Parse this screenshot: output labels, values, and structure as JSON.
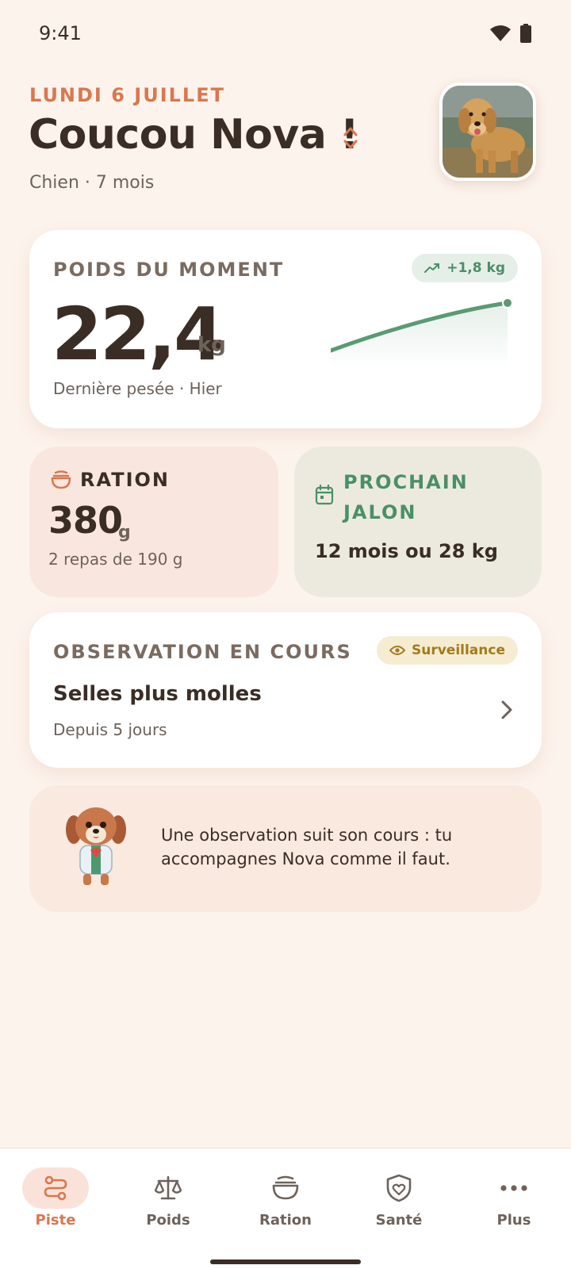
{
  "status_bar": {
    "time": "9:41",
    "icons": [
      "wifi-icon",
      "battery-icon"
    ]
  },
  "header": {
    "date": "LUNDI 6 JUILLET",
    "greeting": "Coucou Nova !",
    "subtitle": "Chien · 7 mois",
    "avatar": "golden-retriever-photo"
  },
  "weight_card": {
    "label": "POIDS DU MOMENT",
    "trend": "+1,8 kg",
    "value": "22,4",
    "unit": "kg",
    "note": "Dernière pesée · Hier"
  },
  "ration_card": {
    "title": "RATION",
    "value": "380",
    "unit": "g",
    "note": "2 repas de 190 g"
  },
  "milestone_card": {
    "title": "PROCHAIN JALON",
    "value": "12 mois ou 28 kg"
  },
  "observation_card": {
    "label": "OBSERVATION EN COURS",
    "badge": "Surveillance",
    "title": "Selles plus molles",
    "subtitle": "Depuis 5 jours"
  },
  "tip_card": {
    "text": "Une observation suit son cours : tu accompagnes Nova comme il faut."
  },
  "bottom_nav": {
    "items": [
      {
        "label": "Piste",
        "icon": "path-icon",
        "active": true
      },
      {
        "label": "Poids",
        "icon": "scale-icon",
        "active": false
      },
      {
        "label": "Ration",
        "icon": "bowl-icon",
        "active": false
      },
      {
        "label": "Santé",
        "icon": "shield-heart-icon",
        "active": false
      },
      {
        "label": "Plus",
        "icon": "more-icon",
        "active": false
      }
    ]
  },
  "colors": {
    "background": "#fcf3ec",
    "accent": "#d9774f",
    "green": "#4b8f67",
    "warning": "#a27b1a"
  }
}
